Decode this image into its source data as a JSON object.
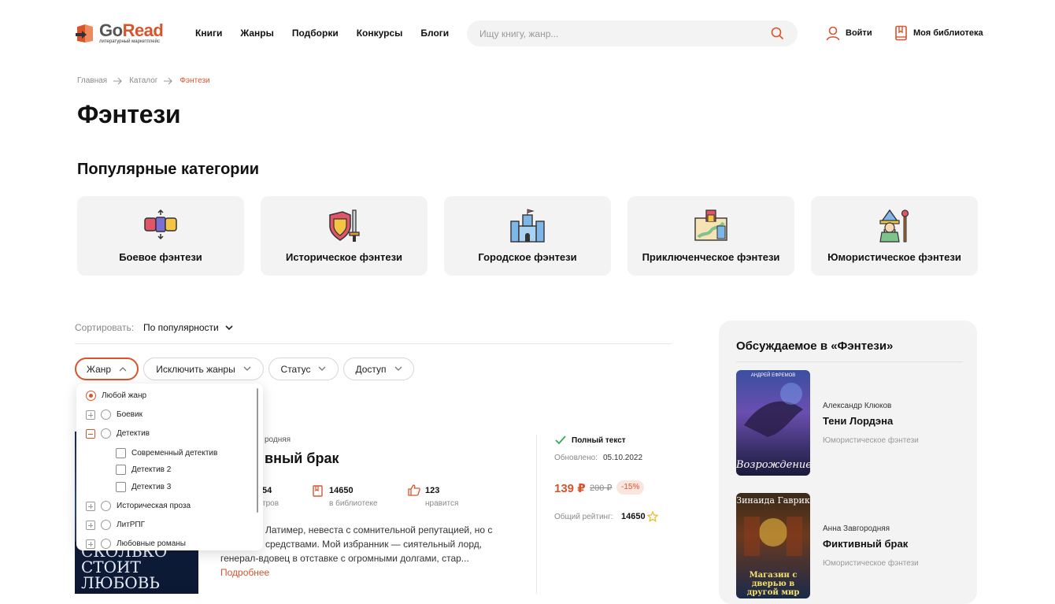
{
  "header": {
    "logo_go": "Go",
    "logo_read": "Read",
    "logo_tagline": "литературный маркетплейс",
    "nav": [
      "Книги",
      "Жанры",
      "Подборки",
      "Конкурсы",
      "Блоги"
    ],
    "search_placeholder": "Ищу книгу, жанр...",
    "login": "Войти",
    "library": "Моя библиотека"
  },
  "breadcrumb": [
    "Главная",
    "Каталог",
    "Фэнтези"
  ],
  "page_title": "Фэнтези",
  "popular": {
    "heading": "Популярные категории",
    "categories": [
      {
        "label": "Боевое фэнтези",
        "icon": "fist-icon"
      },
      {
        "label": "Историческое фэнтези",
        "icon": "shield-sword-icon"
      },
      {
        "label": "Городское фэнтези",
        "icon": "castle-icon"
      },
      {
        "label": "Приключенческое фэнтези",
        "icon": "treasure-map-icon"
      },
      {
        "label": "Юмористическое фэнтези",
        "icon": "wizard-icon"
      }
    ]
  },
  "sort": {
    "label": "Сортировать:",
    "value": "По популярности"
  },
  "filters": [
    "Жанр",
    "Исключить жанры",
    "Статус",
    "Доступ"
  ],
  "genre_dropdown": {
    "items": [
      {
        "label": "Любой жанр",
        "type": "radio-selected"
      },
      {
        "label": "Боевик",
        "type": "expand-radio"
      },
      {
        "label": "Детектив",
        "type": "collapse-radio"
      },
      {
        "label": "Современный детектив",
        "type": "checkbox"
      },
      {
        "label": "Детектив 2",
        "type": "checkbox"
      },
      {
        "label": "Детектив 3",
        "type": "checkbox"
      },
      {
        "label": "Историческая проза",
        "type": "expand-radio"
      },
      {
        "label": "ЛитРПГ",
        "type": "expand-radio"
      },
      {
        "label": "Любовные романы",
        "type": "expand-radio"
      }
    ]
  },
  "book": {
    "author_partial": "родняя",
    "title_partial": "вный брак",
    "cover_text": "СКОЛЬКО СТОИТ ЛЮБОВЬ",
    "stats": [
      {
        "value": "54",
        "label": "тров"
      },
      {
        "value": "14650",
        "label": "в библиотеке"
      },
      {
        "value": "123",
        "label": "нравится"
      }
    ],
    "desc_line1": "Латимер, невеста с сомнительной репутацией, но с",
    "desc_line2": "средствами. Мой избранник — сиятельный лорд,",
    "desc_line3": "генерал-вдовец в отставке с огромными долгами, стар...",
    "more": "Подробнее",
    "full_text": "Полный текст",
    "updated_label": "Обновлено:",
    "updated_value": "05.10.2022",
    "price": "139 ₽",
    "old_price": "200 ₽",
    "discount": "-15%",
    "rating_label": "Общий рейтинг:",
    "rating_value": "14650"
  },
  "sidebar": {
    "heading": "Обсуждаемое в «Фэнтези»",
    "books": [
      {
        "author": "Александр Клюков",
        "title": "Тени Лордэна",
        "genre": "Юмористическое фэнтези",
        "cover_top": "АНДРЕЙ ЕФРЕМОВ",
        "cover_title": "Возрождение"
      },
      {
        "author": "Анна Завгородняя",
        "title": "Фиктивный брак",
        "genre": "Юмористическое фэнтези",
        "cover_top": "Зинаида Гаврик",
        "cover_title": "Магазин с дверью в другой мир"
      }
    ]
  },
  "colors": {
    "accent": "#d9542d",
    "panel": "#f3f3f3"
  }
}
